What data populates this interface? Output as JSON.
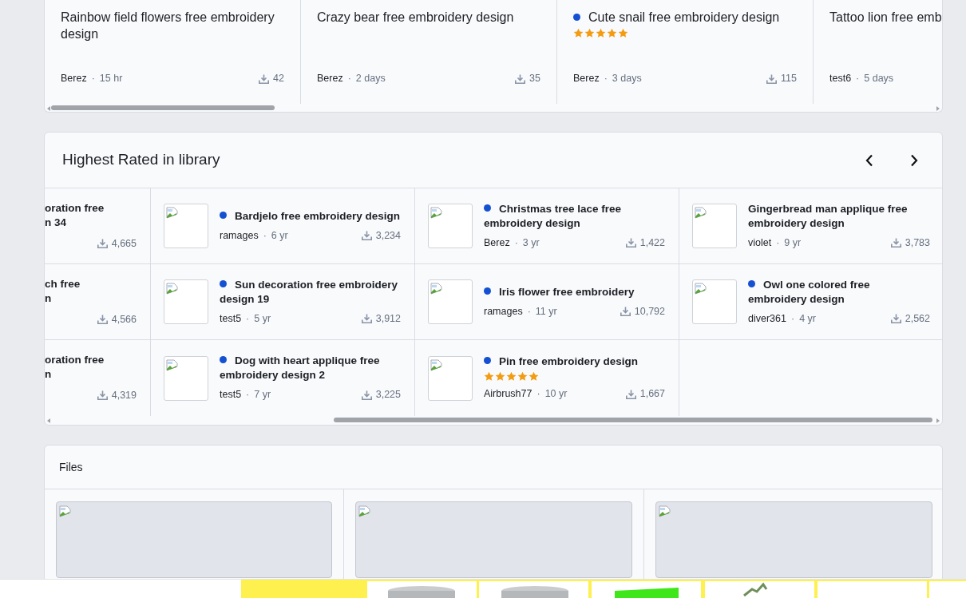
{
  "recent": {
    "items": [
      {
        "title": "Rainbow field flowers free embroidery design",
        "marked": false,
        "author": "Berez",
        "separator": "·",
        "age": "15 hr",
        "downloads": "42"
      },
      {
        "title": "Crazy bear free embroidery design",
        "marked": false,
        "author": "Berez",
        "separator": "·",
        "age": "2 days",
        "downloads": "35"
      },
      {
        "title": "Cute snail free embroidery design",
        "marked": true,
        "stars": 5,
        "author": "Berez",
        "separator": "·",
        "age": "3 days",
        "downloads": "115"
      },
      {
        "title": "Tattoo lion free emb",
        "marked": false,
        "author": "test6",
        "separator": "·",
        "age": "5 days"
      }
    ]
  },
  "highest_rated": {
    "title": "Highest Rated in library",
    "rows": [
      [
        {
          "kind": "clipped",
          "title_lines": [
            "oration free",
            "n 34"
          ],
          "downloads": "4,665"
        },
        {
          "kind": "design",
          "title": "Bardjelo free embroidery design",
          "marked": true,
          "author": "ramages",
          "separator": "·",
          "age": "6 yr",
          "downloads": "3,234"
        },
        {
          "kind": "design",
          "title": "Christmas tree lace free embroidery design",
          "marked": true,
          "author": "Berez",
          "separator": "·",
          "age": "3 yr",
          "downloads": "1,422"
        },
        {
          "kind": "design",
          "title": "Gingerbread man applique free embroidery design",
          "marked": false,
          "author": "violet",
          "separator": "·",
          "age": "9 yr",
          "downloads": "3,783"
        }
      ],
      [
        {
          "kind": "clipped",
          "title_lines": [
            "ch free",
            "n"
          ],
          "downloads": "4,566"
        },
        {
          "kind": "design",
          "title": "Sun decoration free embroidery design 19",
          "marked": true,
          "author": "test5",
          "separator": "·",
          "age": "5 yr",
          "downloads": "3,912"
        },
        {
          "kind": "design",
          "title": "Iris flower free embroidery",
          "marked": true,
          "author": "ramages",
          "separator": "·",
          "age": "11 yr",
          "downloads": "10,792"
        },
        {
          "kind": "design",
          "title": "Owl one colored free embroidery design",
          "marked": true,
          "author": "diver361",
          "separator": "·",
          "age": "4 yr",
          "downloads": "2,562"
        }
      ],
      [
        {
          "kind": "clipped",
          "title_lines": [
            "oration free",
            "n"
          ],
          "downloads": "4,319"
        },
        {
          "kind": "design",
          "title": "Dog with heart applique free embroidery design 2",
          "marked": true,
          "author": "test5",
          "separator": "·",
          "age": "7 yr",
          "downloads": "3,225"
        },
        {
          "kind": "design",
          "title": "Pin free embroidery design",
          "marked": true,
          "stars": 5,
          "author": "Airbrush77",
          "separator": "·",
          "age": "10 yr",
          "downloads": "1,667"
        },
        {
          "kind": "empty"
        }
      ]
    ]
  },
  "files": {
    "title": "Files",
    "cards": [
      {
        "kind": "broken-image"
      },
      {
        "kind": "broken-image"
      },
      {
        "kind": "broken-image"
      }
    ]
  }
}
